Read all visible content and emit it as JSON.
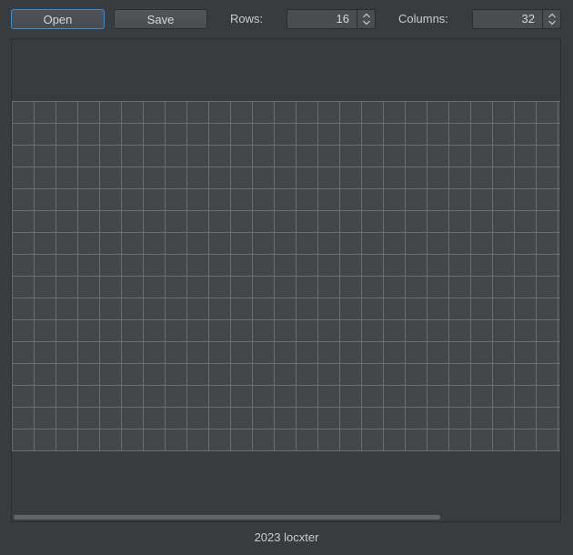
{
  "toolbar": {
    "open_label": "Open",
    "save_label": "Save",
    "rows_label": "Rows:",
    "rows_value": "16",
    "columns_label": "Columns:",
    "columns_value": "32"
  },
  "grid": {
    "rows": 16,
    "visible_columns": 25,
    "cell_color": "#44474a",
    "line_color": "#6a6e72",
    "background": "#393c3f"
  },
  "scrollbar": {
    "position_fraction": 0.0
  },
  "footer": {
    "text": "2023 locxter"
  },
  "icons": {
    "spin_arrows": "up-down-chevron-icon"
  }
}
